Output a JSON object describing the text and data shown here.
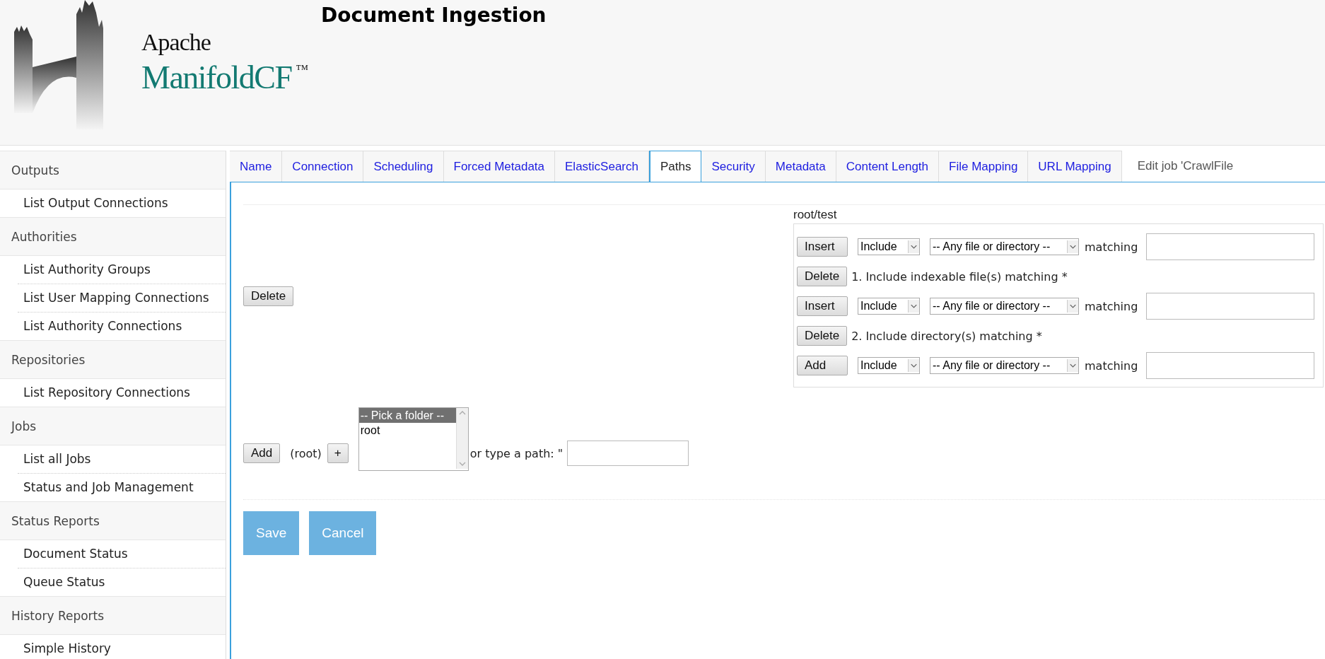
{
  "header": {
    "title": "Document Ingestion",
    "logo": {
      "line1": "Apache",
      "line2": "ManifoldCF",
      "mark": "™"
    }
  },
  "sidebar": {
    "sections": [
      {
        "label": "Outputs",
        "items": [
          {
            "label": "List Output Connections"
          }
        ]
      },
      {
        "label": "Authorities",
        "items": [
          {
            "label": "List Authority Groups"
          },
          {
            "label": "List User Mapping Connections"
          },
          {
            "label": "List Authority Connections"
          }
        ]
      },
      {
        "label": "Repositories",
        "items": [
          {
            "label": "List Repository Connections"
          }
        ]
      },
      {
        "label": "Jobs",
        "items": [
          {
            "label": "List all Jobs"
          },
          {
            "label": "Status and Job Management"
          }
        ]
      },
      {
        "label": "Status Reports",
        "items": [
          {
            "label": "Document Status"
          },
          {
            "label": "Queue Status"
          }
        ]
      },
      {
        "label": "History Reports",
        "items": [
          {
            "label": "Simple History"
          }
        ]
      }
    ]
  },
  "tabs": [
    {
      "label": "Name",
      "selected": false
    },
    {
      "label": "Connection",
      "selected": false
    },
    {
      "label": "Scheduling",
      "selected": false
    },
    {
      "label": "Forced Metadata",
      "selected": false
    },
    {
      "label": "ElasticSearch",
      "selected": false
    },
    {
      "label": "Paths",
      "selected": true
    },
    {
      "label": "Security",
      "selected": false
    },
    {
      "label": "Metadata",
      "selected": false
    },
    {
      "label": "Content Length",
      "selected": false
    },
    {
      "label": "File Mapping",
      "selected": false
    },
    {
      "label": "URL Mapping",
      "selected": false
    }
  ],
  "tab_caption": "Edit job 'CrawlFile",
  "paths": [
    {
      "delete_button": "Delete",
      "path": "root/test",
      "rules": [
        {
          "kind": "editor",
          "button": "Insert",
          "type_select": "Include",
          "target_select": "-- Any file or directory --",
          "matching_label": "matching"
        },
        {
          "kind": "rule",
          "button": "Delete",
          "text": "1. Include indexable file(s) matching *"
        },
        {
          "kind": "editor",
          "button": "Insert",
          "type_select": "Include",
          "target_select": "-- Any file or directory --",
          "matching_label": "matching"
        },
        {
          "kind": "rule",
          "button": "Delete",
          "text": "2. Include directory(s) matching *"
        },
        {
          "kind": "editor",
          "button": "Add",
          "type_select": "Include",
          "target_select": "-- Any file or directory --",
          "matching_label": "matching"
        }
      ]
    }
  ],
  "add_path": {
    "button": "Add",
    "current": "(root)",
    "plus_button": "+",
    "folder_options": [
      {
        "label": "-- Pick a folder --",
        "selected": true
      },
      {
        "label": "root",
        "selected": false
      }
    ],
    "type_label": "or type a path: \""
  },
  "actions": [
    "Save",
    "Cancel"
  ]
}
